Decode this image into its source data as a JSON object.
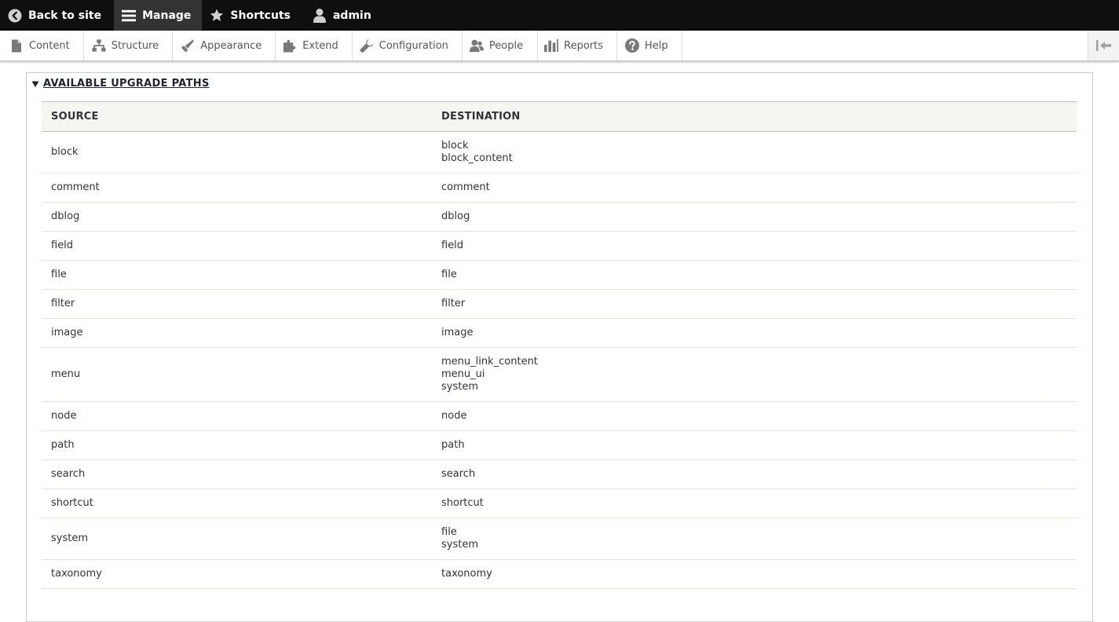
{
  "toolbar": {
    "back_label": "Back to site",
    "manage_label": "Manage",
    "shortcuts_label": "Shortcuts",
    "user_label": "admin"
  },
  "tray": {
    "items": [
      {
        "label": "Content",
        "icon": "file-icon"
      },
      {
        "label": "Structure",
        "icon": "sitemap-icon"
      },
      {
        "label": "Appearance",
        "icon": "paintbrush-icon"
      },
      {
        "label": "Extend",
        "icon": "puzzle-icon"
      },
      {
        "label": "Configuration",
        "icon": "wrench-icon"
      },
      {
        "label": "People",
        "icon": "people-icon"
      },
      {
        "label": "Reports",
        "icon": "bar-chart-icon"
      },
      {
        "label": "Help",
        "icon": "question-icon"
      }
    ]
  },
  "details": {
    "summary": "Available upgrade paths",
    "headers": {
      "source": "Source",
      "destination": "Destination"
    },
    "rows": [
      {
        "source": "block",
        "destinations": [
          "block",
          "block_content"
        ]
      },
      {
        "source": "comment",
        "destinations": [
          "comment"
        ]
      },
      {
        "source": "dblog",
        "destinations": [
          "dblog"
        ]
      },
      {
        "source": "field",
        "destinations": [
          "field"
        ]
      },
      {
        "source": "file",
        "destinations": [
          "file"
        ]
      },
      {
        "source": "filter",
        "destinations": [
          "filter"
        ]
      },
      {
        "source": "image",
        "destinations": [
          "image"
        ]
      },
      {
        "source": "menu",
        "destinations": [
          "menu_link_content",
          "menu_ui",
          "system"
        ]
      },
      {
        "source": "node",
        "destinations": [
          "node"
        ]
      },
      {
        "source": "path",
        "destinations": [
          "path"
        ]
      },
      {
        "source": "search",
        "destinations": [
          "search"
        ]
      },
      {
        "source": "shortcut",
        "destinations": [
          "shortcut"
        ]
      },
      {
        "source": "system",
        "destinations": [
          "file",
          "system"
        ]
      },
      {
        "source": "taxonomy",
        "destinations": [
          "taxonomy"
        ]
      }
    ]
  },
  "colors": {
    "toolbar_bg": "#0f0f0f",
    "toolbar_active_bg": "#333333",
    "icon_gray": "#787878",
    "table_header_bg": "#f5f5f2"
  }
}
